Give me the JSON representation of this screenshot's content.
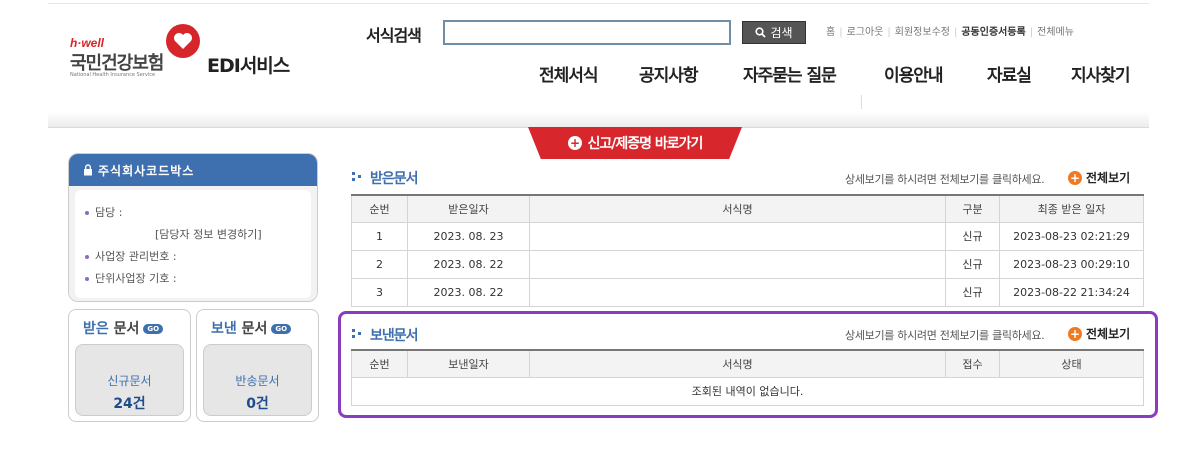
{
  "logo": {
    "hwell": "h·well",
    "nhis": "국민건강보험",
    "nhis_en": "National Health Insurance Service",
    "service": "EDI서비스"
  },
  "search": {
    "label": "서식검색",
    "placeholder": "",
    "button": "검색"
  },
  "util_links": [
    "홈",
    "로그아웃",
    "회원정보수정",
    "공동인증서등록",
    "전체메뉴"
  ],
  "nav": [
    "전체서식",
    "공지사항",
    "자주묻는 질문",
    "이용안내",
    "자료실",
    "지사찾기"
  ],
  "banner": "신고/제증명 바로가기",
  "codebox": {
    "title": "주식회사코드박스",
    "manager_label": "담당 :",
    "change_link": "[담당자 정보 변경하기]",
    "biz_no_label": "사업장 관리번호 :",
    "unit_label": "단위사업장 기호 :"
  },
  "received_box": {
    "accent": "받은",
    "rest": "문서",
    "go": "GO",
    "label": "신규문서",
    "count": "24건"
  },
  "sent_box": {
    "accent": "보낸",
    "rest": "문서",
    "go": "GO",
    "label": "반송문서",
    "count": "0건"
  },
  "received": {
    "title": "받은문서",
    "hint": "상세보기를 하시려면 전체보기를 클릭하세요.",
    "more": "전체보기",
    "headers": [
      "순번",
      "받은일자",
      "서식명",
      "구분",
      "최종 받은 일자"
    ],
    "rows": [
      [
        "1",
        "2023. 08. 23",
        "",
        "신규",
        "2023-08-23 02:21:29"
      ],
      [
        "2",
        "2023. 08. 22",
        "",
        "신규",
        "2023-08-23 00:29:10"
      ],
      [
        "3",
        "2023. 08. 22",
        "",
        "신규",
        "2023-08-22 21:34:24"
      ]
    ]
  },
  "sent": {
    "title": "보낸문서",
    "hint": "상세보기를 하시려면 전체보기를 클릭하세요.",
    "more": "전체보기",
    "headers": [
      "순번",
      "보낸일자",
      "서식명",
      "접수",
      "상태"
    ],
    "empty": "조회된 내역이 없습니다."
  },
  "colors": {
    "brand_red": "#d8262d",
    "primary_blue": "#3e6fae",
    "highlight": "#8a3cc0",
    "more_orange": "#f07a22"
  }
}
